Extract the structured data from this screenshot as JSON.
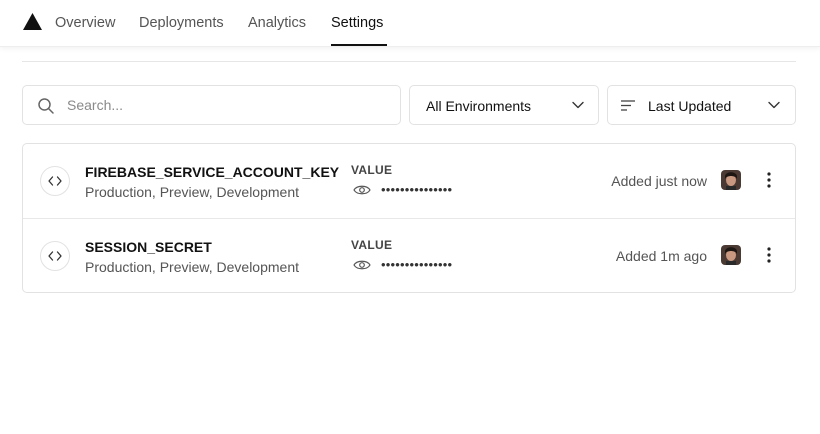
{
  "nav": {
    "tabs": [
      {
        "label": "Overview"
      },
      {
        "label": "Deployments"
      },
      {
        "label": "Analytics"
      },
      {
        "label": "Settings",
        "active": true
      }
    ]
  },
  "filters": {
    "search_placeholder": "Search...",
    "environment_select": "All Environments",
    "sort_select": "Last Updated"
  },
  "env_vars": [
    {
      "name": "FIREBASE_SERVICE_ACCOUNT_KEY",
      "environments": "Production, Preview, Development",
      "value_label": "VALUE",
      "masked_value": "•••••••••••••••",
      "added": "Added just now"
    },
    {
      "name": "SESSION_SECRET",
      "environments": "Production, Preview, Development",
      "value_label": "VALUE",
      "masked_value": "•••••••••••••••",
      "added": "Added 1m ago"
    }
  ],
  "icons": {
    "logo": "triangle-logo-icon",
    "search": "search-icon",
    "chevron": "chevron-down-icon",
    "sort": "sort-lines-icon",
    "code": "code-icon",
    "eye": "eye-icon",
    "menu": "more-vertical-icon"
  },
  "colors": {
    "text": "#111111",
    "muted": "#555555",
    "border": "#e2e2e2",
    "accent": "#111111"
  }
}
